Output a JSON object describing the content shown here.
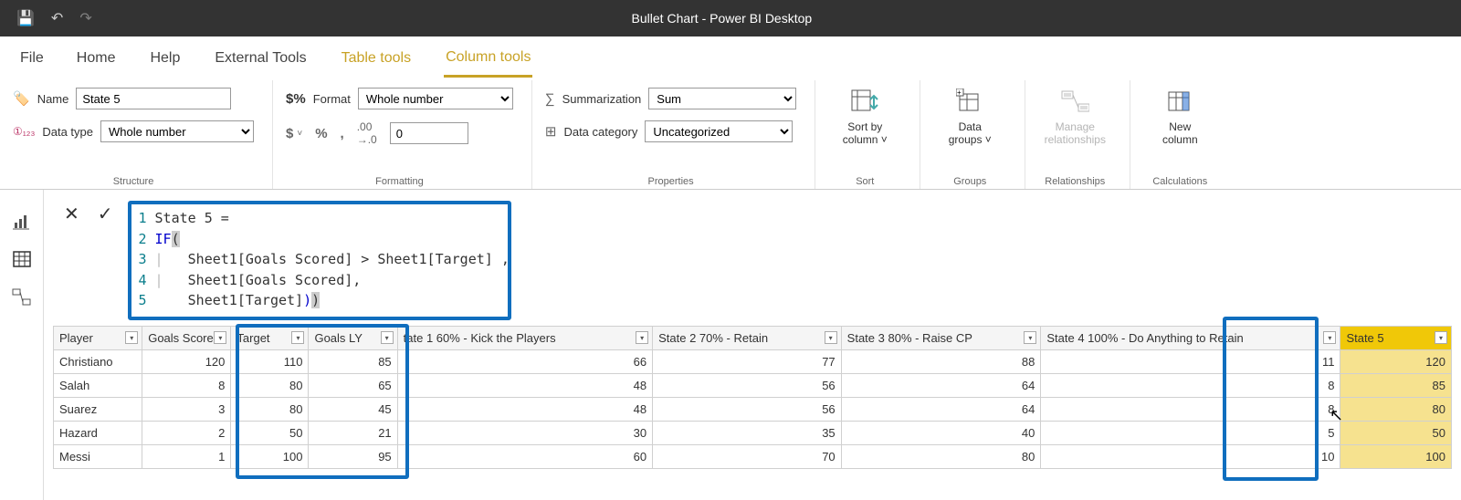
{
  "titlebar": {
    "title": "Bullet Chart - Power BI Desktop"
  },
  "tabs": {
    "file": "File",
    "home": "Home",
    "help": "Help",
    "external": "External Tools",
    "table": "Table tools",
    "column": "Column tools"
  },
  "ribbon": {
    "name_label": "Name",
    "name_value": "State 5",
    "datatype_label": "Data type",
    "datatype_value": "Whole number",
    "structure_group": "Structure",
    "format_label": "Format",
    "format_value": "Whole number",
    "decimals_value": "0",
    "formatting_group": "Formatting",
    "summarization_label": "Summarization",
    "summarization_value": "Sum",
    "datacategory_label": "Data category",
    "datacategory_value": "Uncategorized",
    "properties_group": "Properties",
    "sort": {
      "line1": "Sort by",
      "line2": "column ˅",
      "group": "Sort"
    },
    "groups": {
      "line1": "Data",
      "line2": "groups ˅",
      "group": "Groups"
    },
    "rel": {
      "line1": "Manage",
      "line2": "relationships",
      "group": "Relationships"
    },
    "calc": {
      "line1": "New",
      "line2": "column",
      "group": "Calculations"
    }
  },
  "formula": {
    "l1": "State 5 =",
    "l2_kw": "IF",
    "l3": "Sheet1[Goals Scored] > Sheet1[Target] ,",
    "l4": "Sheet1[Goals Scored],",
    "l5": "Sheet1[Target]"
  },
  "table": {
    "headers": [
      "Player",
      "Goals Scored",
      "Target",
      "Goals LY",
      "tate 1 60% - Kick the Players",
      "State 2 70% - Retain",
      "State 3 80% - Raise CP",
      "State 4 100% - Do Anything to Retain",
      "State 5"
    ],
    "rows": [
      {
        "c0": "Christiano",
        "c1": "120",
        "c2": "110",
        "c3": "85",
        "c4": "66",
        "c5": "77",
        "c6": "88",
        "c7": "11",
        "c8": "120"
      },
      {
        "c0": "Salah",
        "c1": "8",
        "c2": "80",
        "c3": "65",
        "c4": "48",
        "c5": "56",
        "c6": "64",
        "c7": "8",
        "c8": "85"
      },
      {
        "c0": "Suarez",
        "c1": "3",
        "c2": "80",
        "c3": "45",
        "c4": "48",
        "c5": "56",
        "c6": "64",
        "c7": "8",
        "c8": "80"
      },
      {
        "c0": "Hazard",
        "c1": "2",
        "c2": "50",
        "c3": "21",
        "c4": "30",
        "c5": "35",
        "c6": "40",
        "c7": "5",
        "c8": "50"
      },
      {
        "c0": "Messi",
        "c1": "1",
        "c2": "100",
        "c3": "95",
        "c4": "60",
        "c5": "70",
        "c6": "80",
        "c7": "10",
        "c8": "100"
      }
    ]
  }
}
